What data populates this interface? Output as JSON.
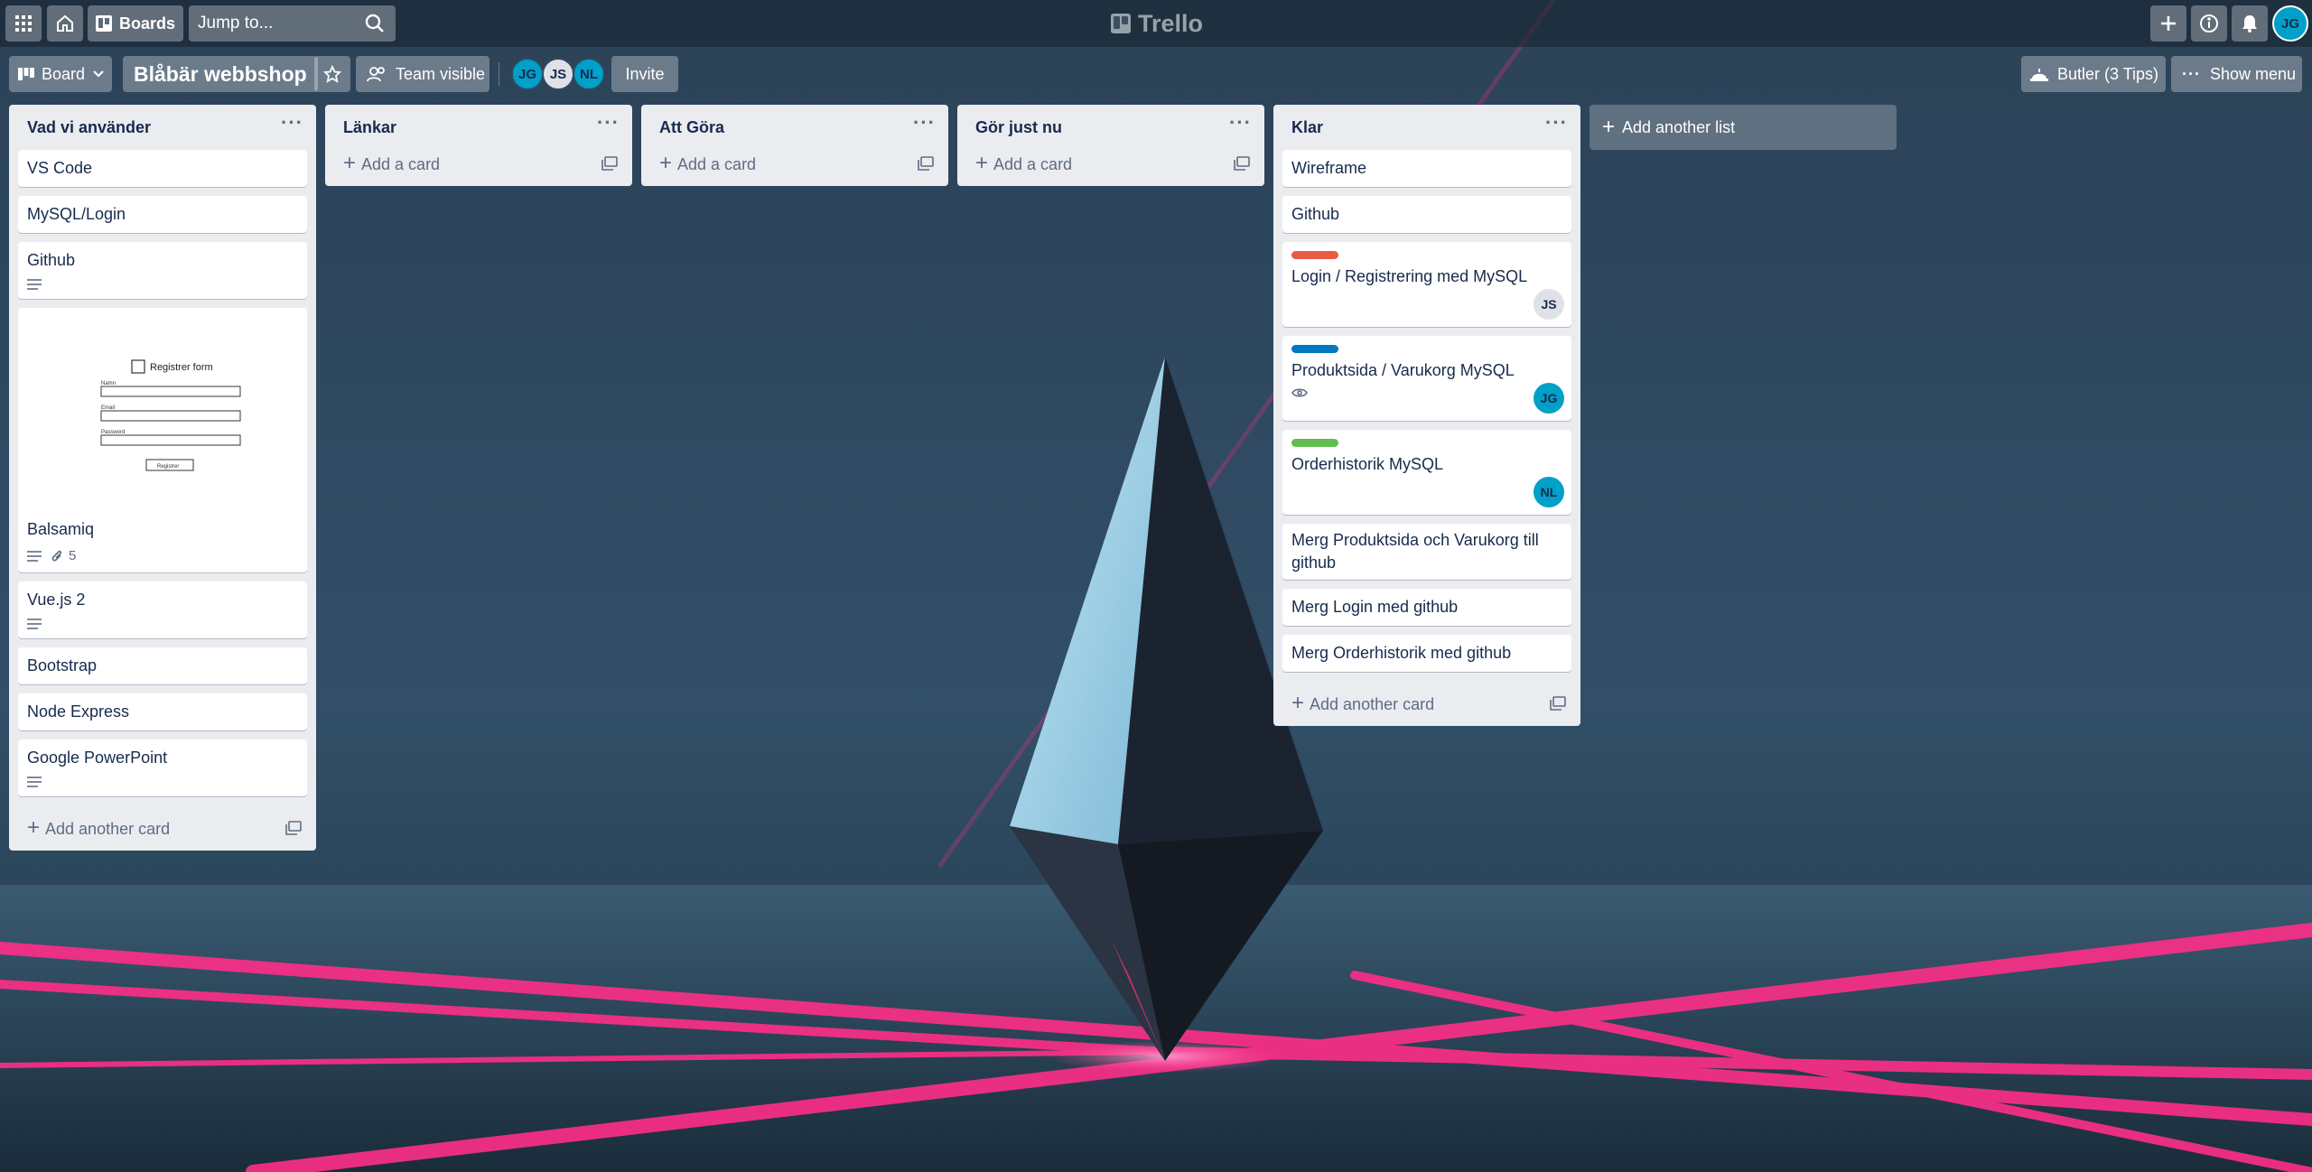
{
  "header": {
    "boards_label": "Boards",
    "search_placeholder": "Jump to...",
    "logo_text": "Trello",
    "user_initials": "JG"
  },
  "board": {
    "view_label": "Board",
    "title": "Blåbär webbshop",
    "visibility_label": "Team visible",
    "members": [
      {
        "initials": "JG",
        "color": "#00a0c8"
      },
      {
        "initials": "JS",
        "color": "#dfe1e6"
      },
      {
        "initials": "NL",
        "color": "#00a0c8"
      }
    ],
    "invite_label": "Invite",
    "butler_label": "Butler (3 Tips)",
    "show_menu_label": "Show menu"
  },
  "lists": [
    {
      "title": "Vad vi använder",
      "cards": [
        {
          "title": "VS Code"
        },
        {
          "title": "MySQL/Login"
        },
        {
          "title": "Github"
        },
        {
          "title": "Balsamiq",
          "attachments": "5"
        },
        {
          "title": "Vue.js 2"
        },
        {
          "title": "Bootstrap"
        },
        {
          "title": "Node Express"
        },
        {
          "title": "Google PowerPoint"
        }
      ],
      "add_label": "Add another card",
      "preview": {
        "form_title": "Registrer form",
        "field_1": "Namn",
        "field_2": "Email",
        "field_3": "Password",
        "button": "Registrer"
      }
    },
    {
      "title": "Länkar",
      "add_label": "Add a card"
    },
    {
      "title": "Att Göra",
      "add_label": "Add a card"
    },
    {
      "title": "Gör just nu",
      "add_label": "Add a card"
    },
    {
      "title": "Klar",
      "cards": [
        {
          "title": "Wireframe"
        },
        {
          "title": "Github"
        },
        {
          "title": "Login / Registrering med MySQL",
          "label_color": "#eb5a46",
          "member": "JS"
        },
        {
          "title": "Produktsida / Varukorg MySQL",
          "label_color": "#0079bf",
          "member": "JG"
        },
        {
          "title": "Orderhistorik MySQL",
          "label_color": "#61bd4f",
          "member": "NL"
        },
        {
          "title": "Merg Produktsida och Varukorg till github"
        },
        {
          "title": "Merg Login med github"
        },
        {
          "title": "Merg Orderhistorik med github"
        }
      ],
      "add_label": "Add another card"
    }
  ],
  "add_list_label": "Add another list",
  "colors": {
    "accent_teal": "#00a0c8",
    "label_red": "#eb5a46",
    "label_blue": "#0079bf",
    "label_green": "#61bd4f"
  }
}
